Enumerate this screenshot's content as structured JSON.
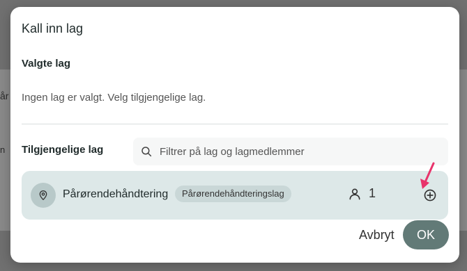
{
  "background": {
    "fragment_top": "år",
    "fragment_bottom": "n"
  },
  "dialog": {
    "title": "Kall inn lag",
    "selected_label": "Valgte lag",
    "empty_text": "Ingen lag er valgt. Velg tilgjengelige lag.",
    "available_label": "Tilgjengelige lag",
    "search": {
      "placeholder": "Filtrer på lag og lagmedlemmer",
      "value": "",
      "icon": "search-icon"
    },
    "teams": [
      {
        "name": "Pårørendehåndtering",
        "tag": "Pårørendehåndteringslag",
        "member_count": "1",
        "icon": "map-pin-icon",
        "action_icon": "plus-circle-icon"
      }
    ],
    "buttons": {
      "cancel": "Avbryt",
      "ok": "OK"
    },
    "colors": {
      "ok_button": "#627a77",
      "team_row_bg": "#dde8e8",
      "annotation_arrow": "#e8336b"
    }
  }
}
